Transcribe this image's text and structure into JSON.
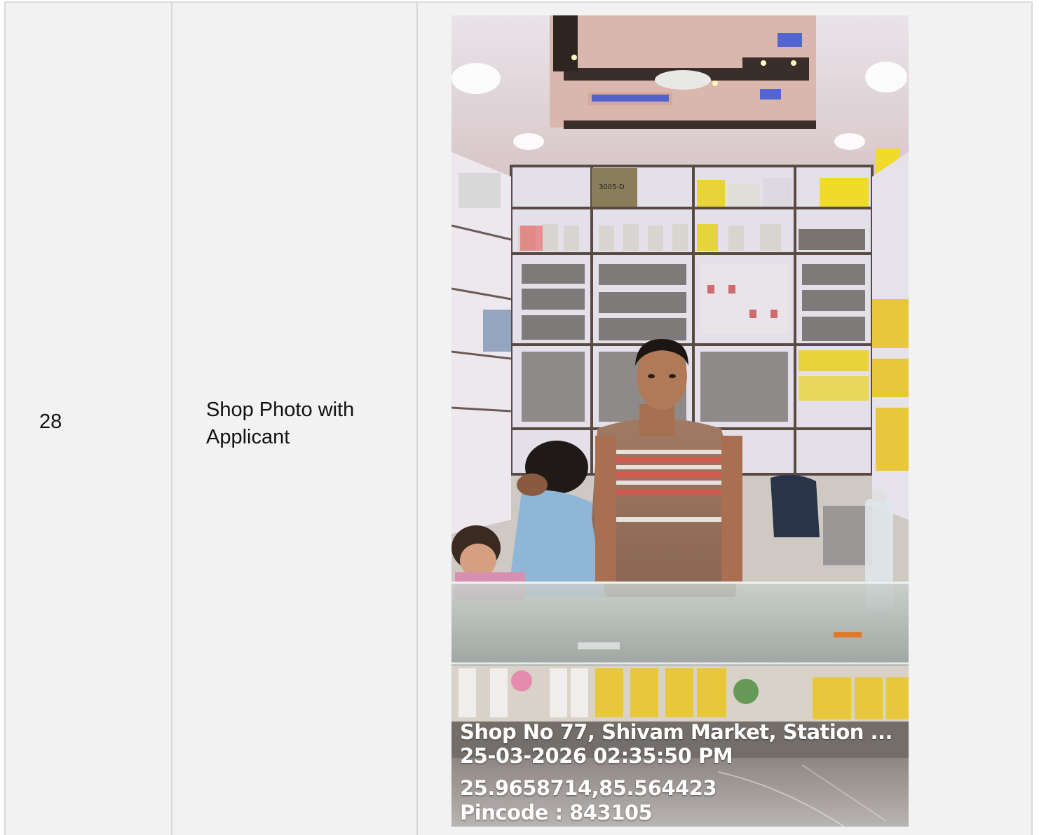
{
  "row": {
    "number": "28",
    "label": "Shop Photo with Applicant"
  },
  "photo": {
    "caption_address": "Shop No 77, Shivam Market, Station ...",
    "caption_datetime": "25-03-2026 02:35:50 PM",
    "caption_coords": "25.9658714,85.564423",
    "caption_pincode": "Pincode : 843105",
    "box_label": "3005-D"
  },
  "colors": {
    "cell_bg": "#f2f2f2",
    "border": "#d9d9d9"
  }
}
